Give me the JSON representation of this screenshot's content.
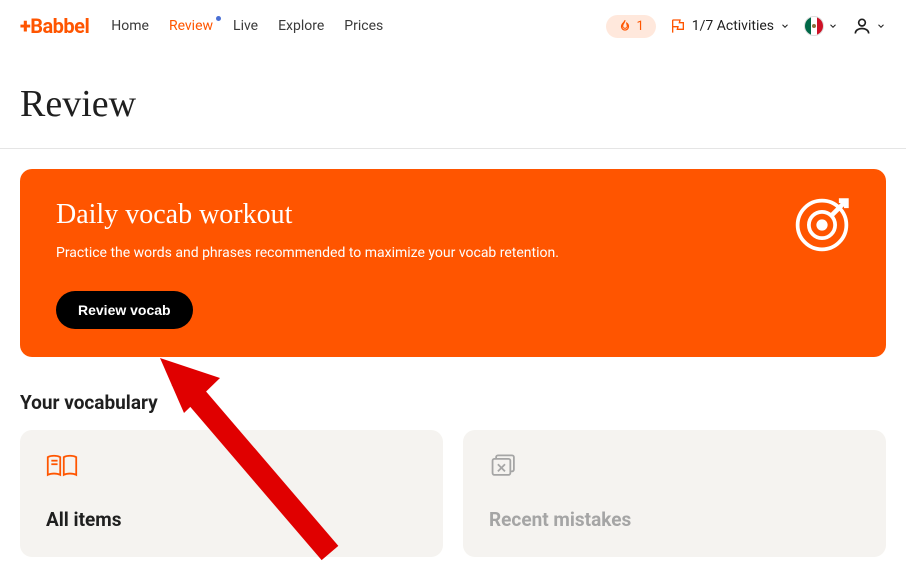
{
  "brand": "Babbel",
  "nav": {
    "home": "Home",
    "review": "Review",
    "live": "Live",
    "explore": "Explore",
    "prices": "Prices"
  },
  "header": {
    "streak_count": "1",
    "activities_label": "1/7 Activities"
  },
  "page_title": "Review",
  "workout": {
    "title": "Daily vocab workout",
    "description": "Practice the words and phrases recommended to maximize your vocab retention.",
    "button": "Review vocab"
  },
  "vocab": {
    "section_title": "Your vocabulary",
    "all_items": "All items",
    "recent_mistakes": "Recent mistakes"
  }
}
